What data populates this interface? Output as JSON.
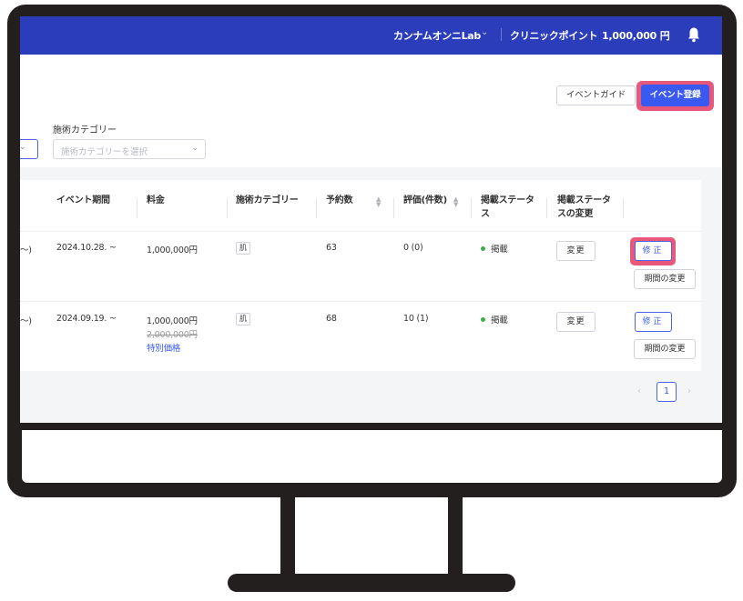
{
  "header": {
    "clinic_name": "カンナムオンニLab",
    "clinic_chevron": "⌄",
    "points_label": "クリニックポイント",
    "points_value": "1,000,000 円",
    "points_chevron": "›"
  },
  "actions": {
    "guide_label": "イベントガイド",
    "register_label": "イベント登録"
  },
  "filter": {
    "category_label": "施術カテゴリー",
    "category_placeholder": "施術カテゴリーを選択"
  },
  "table": {
    "headers": {
      "period": "イベント期間",
      "price": "料金",
      "category": "施術カテゴリー",
      "reservations": "予約数",
      "rating": "評価(件数)",
      "status_line1": "掲載ステータ",
      "status_line2": "ス",
      "change_line1": "掲載ステータ",
      "change_line2": "スの変更"
    },
    "rows": [
      {
        "name_tail": "〜)",
        "period": "2024.10.28. ~",
        "price": "1,000,000円",
        "category_tag": "肌",
        "reservations": "63",
        "rating": "0 (0)",
        "status": "掲載",
        "change_label": "変更",
        "edit_label": "修正",
        "period_change_label": "期間の変更"
      },
      {
        "name_tail": "〜)",
        "period": "2024.09.19. ~",
        "price": "1,000,000円",
        "original_price": "2,000,000円",
        "special_label": "特別価格",
        "category_tag": "肌",
        "reservations": "68",
        "rating": "10 (1)",
        "status": "掲載",
        "change_label": "変更",
        "edit_label": "修正",
        "period_change_label": "期間の変更"
      }
    ]
  },
  "pagination": {
    "prev": "‹",
    "current": "1",
    "next": "›"
  },
  "colors": {
    "header_bg": "#2b3dbb",
    "accent": "#3a59f1",
    "highlight": "#e8587a",
    "status_dot": "#3cb043"
  },
  "icons": {
    "bell": "bell-icon",
    "sort": "sort-icon"
  }
}
